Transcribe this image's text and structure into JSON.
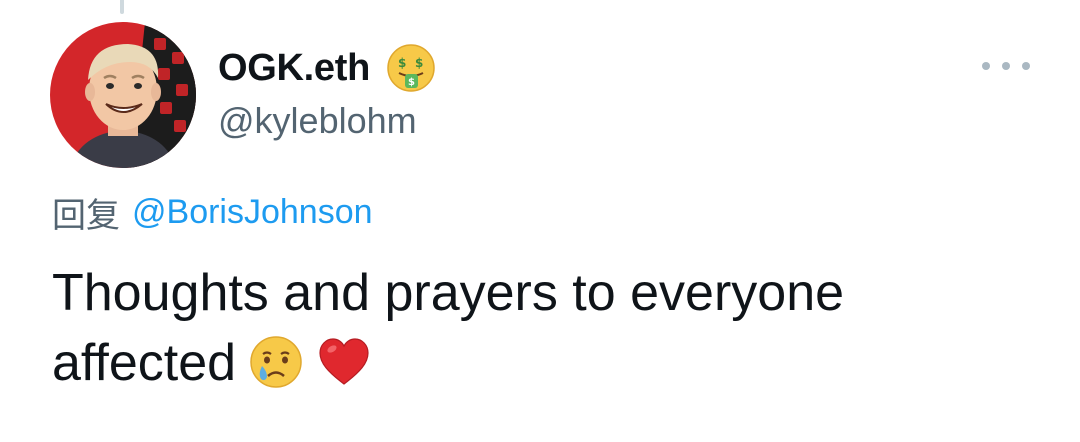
{
  "tweet": {
    "author": {
      "display_name": "OGK.eth",
      "name_emoji": "money-mouth-face",
      "handle": "@kyleblohm"
    },
    "reply": {
      "prefix": "回复",
      "mention": "@BorisJohnson"
    },
    "text_line1": "Thoughts and prayers to everyone",
    "text_line2": "affected",
    "text_emojis": [
      "crying-face",
      "red-heart"
    ]
  },
  "colors": {
    "text_primary": "#0f1419",
    "text_secondary": "#536471",
    "mention_blue": "#1d9bf0",
    "avatar_background": "#d3262a",
    "thread_line": "#cfd9de"
  }
}
